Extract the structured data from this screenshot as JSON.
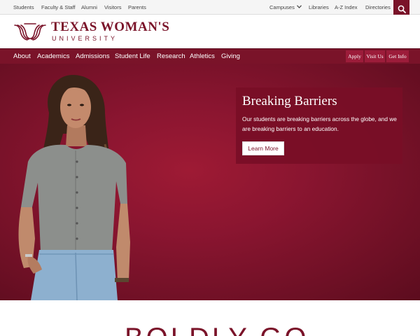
{
  "utility_nav": {
    "links": [
      "Students",
      "Faculty & Staff",
      "Alumni",
      "Visitors",
      "Parents"
    ],
    "right_links": [
      "Campuses",
      "Libraries",
      "A-Z Index",
      "Directories"
    ],
    "search_icon": "search-icon"
  },
  "brand": {
    "name_line1": "TEXAS WOMAN'S",
    "name_line2": "UNIVERSITY",
    "color": "#7a1329"
  },
  "main_nav": {
    "items": [
      "About",
      "Academics",
      "Admissions",
      "Student Life",
      "Research",
      "Athletics",
      "Giving"
    ],
    "cta": [
      "Apply",
      "Visit Us",
      "Get Info"
    ]
  },
  "hero": {
    "title": "Breaking Barriers",
    "text": "Our students are breaking barriers across the globe, and we are breaking barriers to an education.",
    "button": "Learn More"
  },
  "section": {
    "heading": "BOLDLY GO"
  }
}
